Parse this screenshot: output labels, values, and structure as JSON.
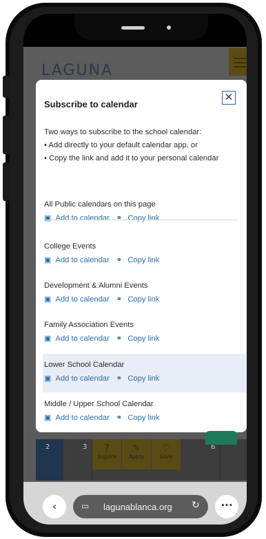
{
  "site": {
    "logo_text": "LAGUNA"
  },
  "modal": {
    "title": "Subscribe to calendar",
    "close_glyph": "✕",
    "intro": "Two ways to subscribe to the school calendar:",
    "bullets": [
      "•  Add directly to your default calendar app, or",
      "•  Copy the link and add it to your personal calendar"
    ],
    "add_label": "Add to calendar",
    "copy_label": "Copy link",
    "calendars": [
      {
        "name": "All Public calendars on this page"
      },
      {
        "name": "College Events"
      },
      {
        "name": "Development & Alumni Events"
      },
      {
        "name": "Family Association Events"
      },
      {
        "name": "Lower School Calendar"
      },
      {
        "name": "Middle / Upper School Calendar"
      }
    ]
  },
  "background_calendar": {
    "day_numbers": [
      "2",
      "3",
      "6"
    ],
    "quick_links": [
      "Inquire",
      "Apply",
      "Give"
    ]
  },
  "browser": {
    "url": "lagunablanca.org",
    "back_glyph": "‹",
    "more_glyph": "···"
  },
  "colors": {
    "link": "#2d6fa8",
    "highlight_row": "#e8edf6",
    "close_border": "#2f5fa6"
  },
  "icons": [
    "calendar-add-icon",
    "link-icon",
    "close-icon",
    "tab-icon",
    "reload-icon",
    "back-icon",
    "more-icon"
  ]
}
